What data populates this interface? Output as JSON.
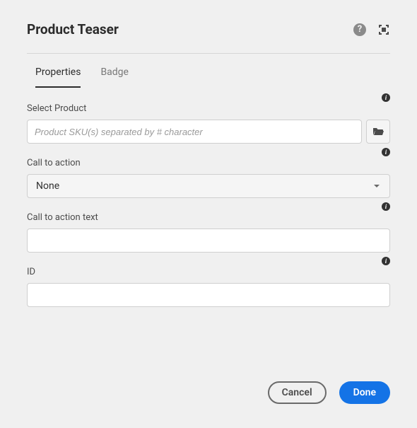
{
  "dialog": {
    "title": "Product Teaser"
  },
  "tabs": [
    {
      "label": "Properties",
      "active": true
    },
    {
      "label": "Badge",
      "active": false
    }
  ],
  "fields": {
    "selectProduct": {
      "label": "Select Product",
      "placeholder": "Product SKU(s) separated by # character",
      "value": ""
    },
    "callToAction": {
      "label": "Call to action",
      "selected": "None",
      "options": [
        "None"
      ]
    },
    "callToActionText": {
      "label": "Call to action text",
      "value": ""
    },
    "id": {
      "label": "ID",
      "value": ""
    }
  },
  "buttons": {
    "cancel": "Cancel",
    "done": "Done"
  }
}
